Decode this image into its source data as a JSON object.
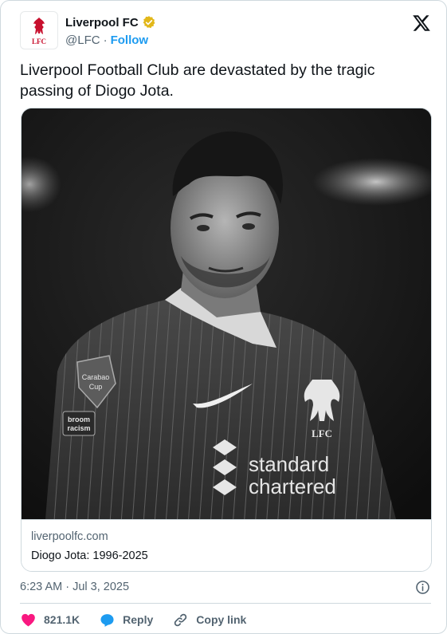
{
  "author": {
    "name": "Liverpool FC",
    "handle": "@LFC",
    "separator": "·",
    "follow_label": "Follow",
    "verified_color": "#e2b719",
    "avatar_text": "LFC"
  },
  "tweet": {
    "text": "Liverpool Football Club are devastated by the tragic passing of Diogo Jota."
  },
  "media": {
    "photo_icon": "player-portrait-image",
    "shirt_sponsor_line1": "standard",
    "shirt_sponsor_line2": "chartered",
    "sleeve_badge_line1": "Carabao",
    "sleeve_badge_line2": "Cup",
    "sleeve_patch_line1": "broom",
    "sleeve_patch_line2": "racism",
    "crest_text": "LFC",
    "link_domain": "liverpoolfc.com",
    "link_title": "Diogo Jota: 1996-2025"
  },
  "meta": {
    "timestamp": "6:23 AM · Jul 3, 2025"
  },
  "actions": {
    "like_count": "821.1K",
    "reply_label": "Reply",
    "copy_label": "Copy link",
    "like_color": "#f91880",
    "reply_color": "#1d9bf0"
  }
}
